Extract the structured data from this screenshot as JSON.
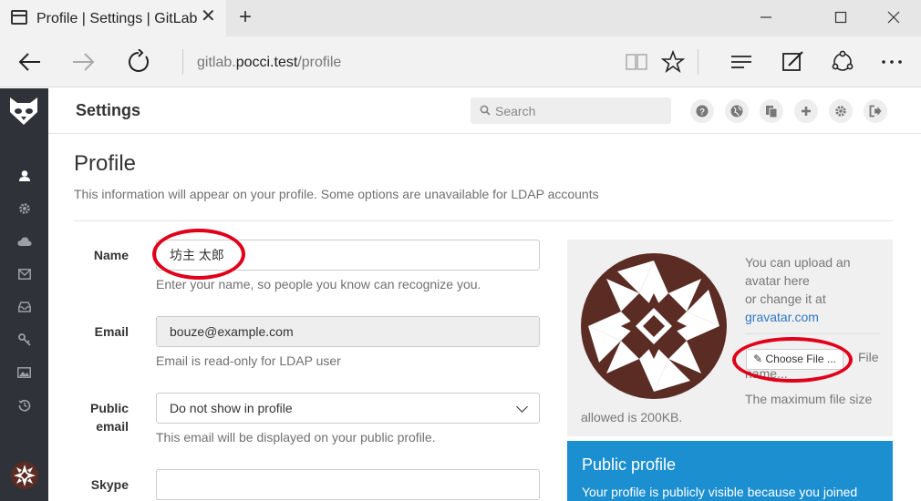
{
  "browser": {
    "tab_title": "Profile | Settings | GitLab",
    "url_prefix": "gitlab.",
    "url_host": "pocci.test",
    "url_path": "/profile"
  },
  "header": {
    "title": "Settings",
    "search_placeholder": "Search"
  },
  "sidebar": {
    "items": [
      "profile-icon",
      "gear-icon",
      "cloud-icon",
      "mail-icon",
      "inbox-icon",
      "key-icon",
      "image-icon",
      "history-icon"
    ]
  },
  "page": {
    "title": "Profile",
    "description": "This information will appear on your profile. Some options are unavailable for LDAP accounts"
  },
  "form": {
    "name_label": "Name",
    "name_value": "坊主 太郎",
    "name_help": "Enter your name, so people you know can recognize you.",
    "email_label": "Email",
    "email_value": "bouze@example.com",
    "email_help": "Email is read-only for LDAP user",
    "public_email_label_1": "Public",
    "public_email_label_2": "email",
    "public_email_value": "Do not show in profile",
    "public_email_help": "This email will be displayed on your public profile.",
    "skype_label": "Skype",
    "skype_value": ""
  },
  "avatar": {
    "note_1": "You can upload an",
    "note_2": "avatar here",
    "note_3": "or change it at",
    "gravatar_link": "gravatar.com",
    "choose_file": "Choose File ...",
    "file_word": "File",
    "file_name": "name...",
    "max_size": "The maximum file size",
    "allowed": "allowed is 200KB."
  },
  "public_profile": {
    "title": "Public profile",
    "text": "Your profile is publicly visible because you joined"
  },
  "colors": {
    "sidebar": "#2f3339",
    "avatar_brown": "#5a2c24",
    "public_blue": "#1c8fd0",
    "highlight_red": "#e0001a",
    "link": "#2e78c2"
  }
}
